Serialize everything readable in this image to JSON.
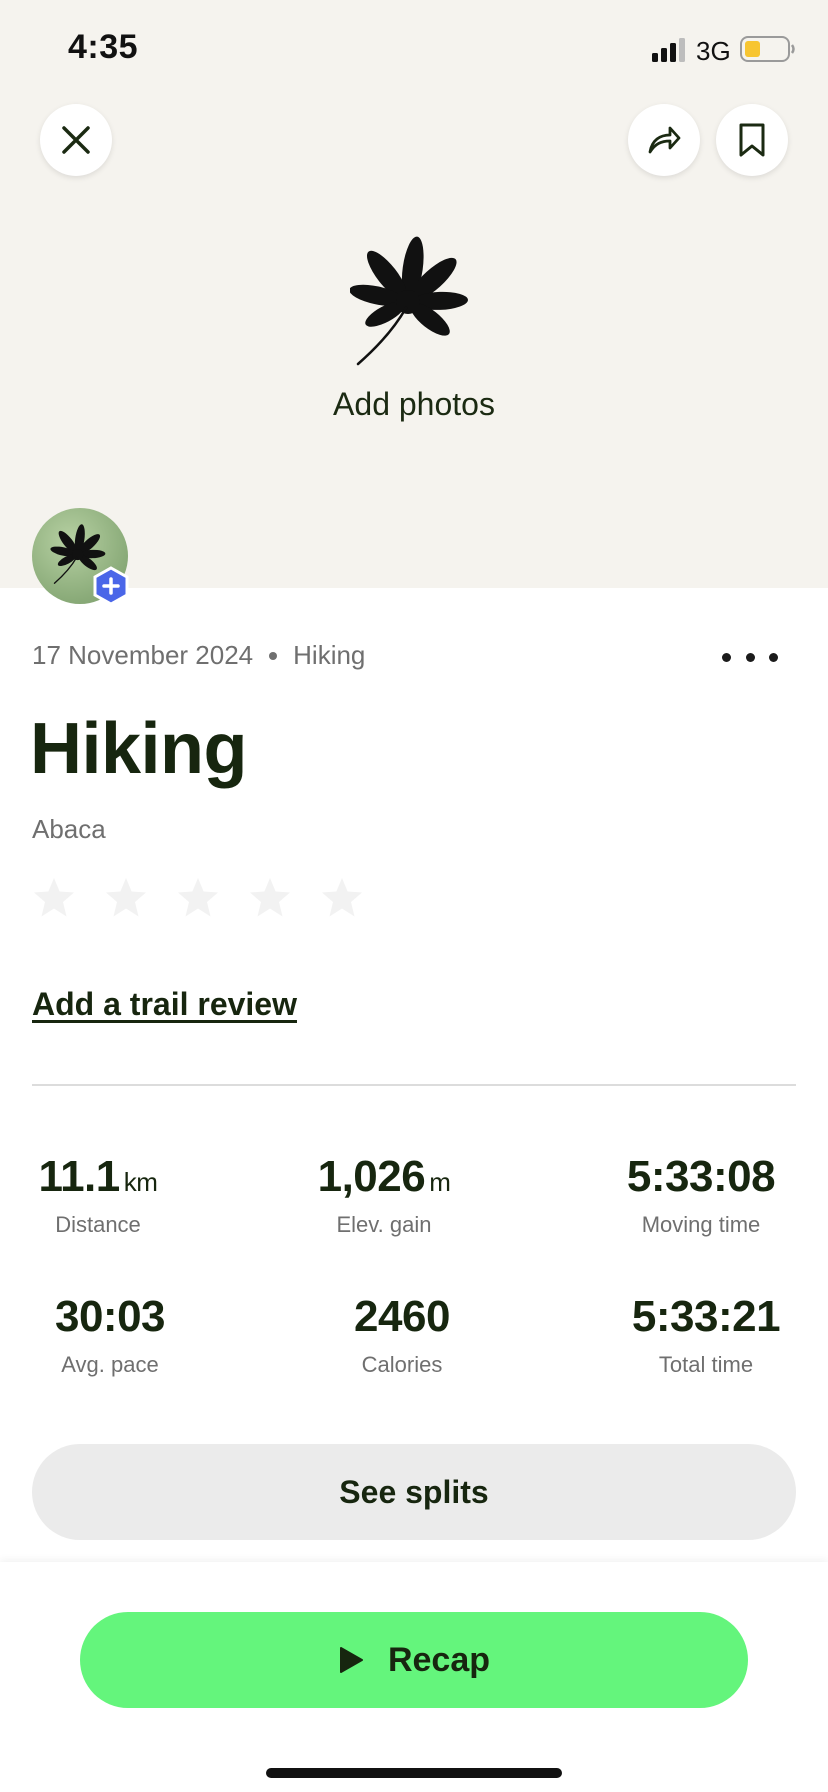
{
  "status_bar": {
    "time": "4:35",
    "network": "3G",
    "battery_color": "#f7c531",
    "icons": [
      "signal-icon",
      "battery-icon"
    ]
  },
  "header": {
    "icons": [
      "close-icon",
      "share-icon",
      "bookmark-icon",
      "leaf-icon"
    ],
    "add_photos_label": "Add photos"
  },
  "activity": {
    "date": "17 November 2024",
    "type": "Hiking",
    "title": "Hiking",
    "location": "Abaca",
    "rating": {
      "max": 5,
      "value": 0
    },
    "review_link": "Add a trail review"
  },
  "stats": [
    {
      "value": "11.1",
      "unit": "km",
      "label": "Distance"
    },
    {
      "value": "1,026",
      "unit": "m",
      "label": "Elev. gain"
    },
    {
      "value": "5:33:08",
      "unit": "",
      "label": "Moving time"
    },
    {
      "value": "30:03",
      "unit": "",
      "label": "Avg. pace"
    },
    {
      "value": "2460",
      "unit": "",
      "label": "Calories"
    },
    {
      "value": "5:33:21",
      "unit": "",
      "label": "Total time"
    }
  ],
  "buttons": {
    "see_splits": "See splits",
    "recap": "Recap"
  },
  "colors": {
    "accent_green": "#64f57c",
    "text_dark": "#17260f",
    "hero_bg": "#f5f3ee",
    "badge_blue": "#4a66e8"
  }
}
